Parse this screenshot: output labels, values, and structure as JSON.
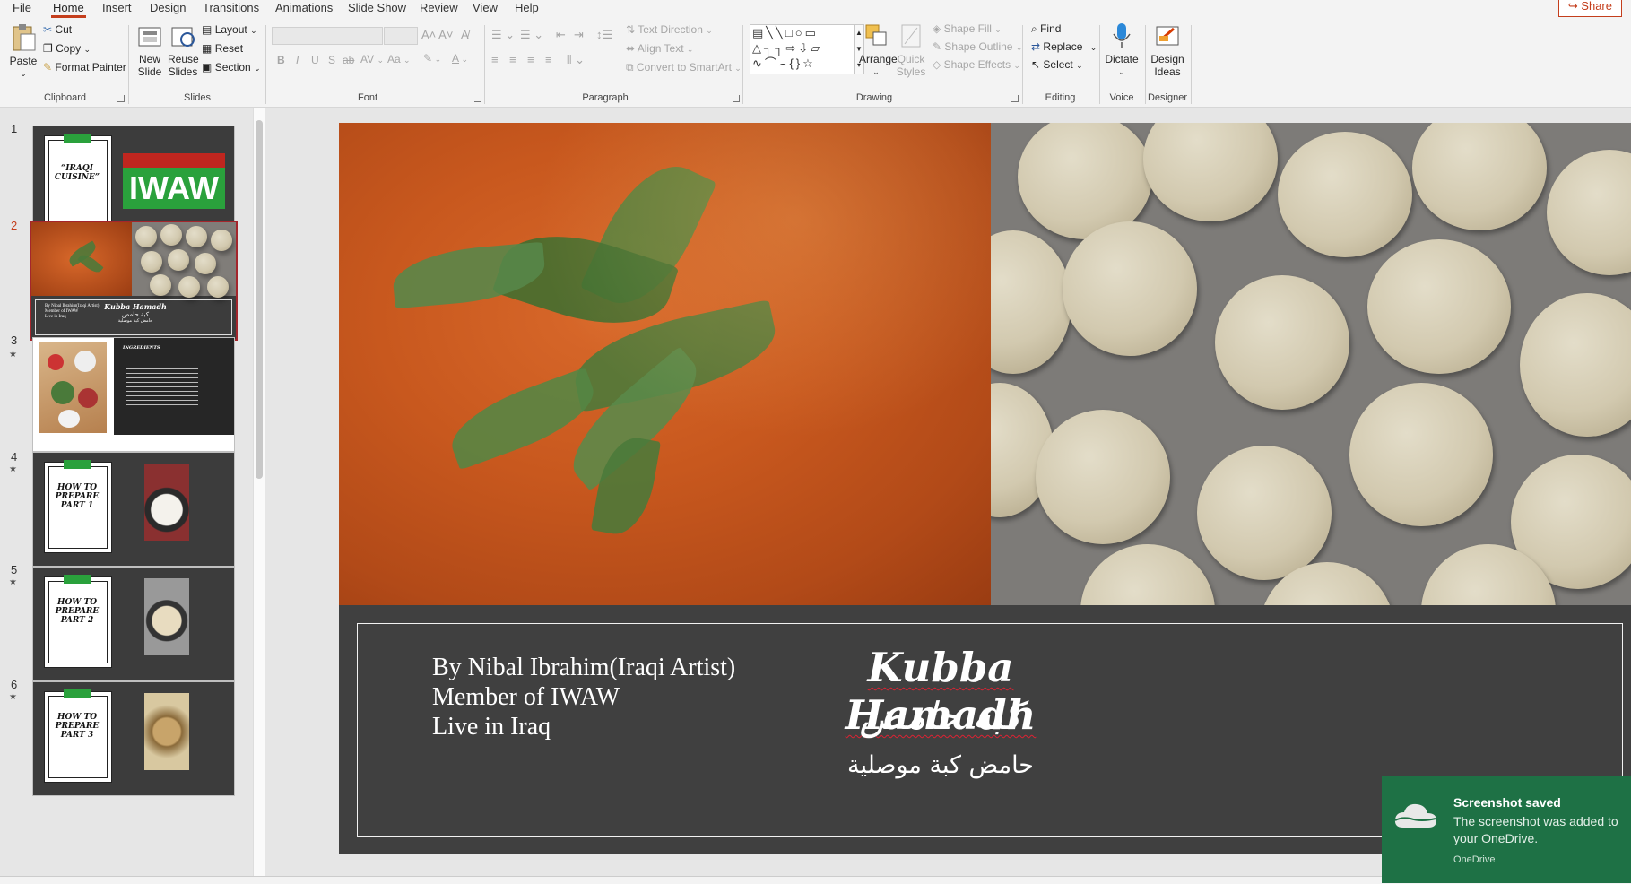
{
  "menu": {
    "tabs": [
      "File",
      "Home",
      "Insert",
      "Design",
      "Transitions",
      "Animations",
      "Slide Show",
      "Review",
      "View",
      "Help"
    ],
    "share": "Share"
  },
  "ribbon": {
    "clipboard": {
      "paste": "Paste",
      "cut": "Cut",
      "copy": "Copy",
      "format_painter": "Format Painter",
      "label": "Clipboard"
    },
    "slides": {
      "new_slide": "New Slide",
      "reuse_slides": "Reuse Slides",
      "layout": "Layout",
      "reset": "Reset",
      "section": "Section",
      "label": "Slides"
    },
    "font": {
      "label": "Font",
      "bold": "B",
      "italic": "I",
      "underline": "U",
      "strike": "S",
      "strike2": "ab",
      "spacing": "AV",
      "case": "Aa"
    },
    "paragraph": {
      "label": "Paragraph",
      "text_direction": "Text Direction",
      "align_text": "Align Text",
      "convert_smartart": "Convert to SmartArt"
    },
    "drawing": {
      "label": "Drawing",
      "arrange": "Arrange",
      "quick_styles": "Quick Styles",
      "shape_fill": "Shape Fill",
      "shape_outline": "Shape Outline",
      "shape_effects": "Shape Effects"
    },
    "editing": {
      "label": "Editing",
      "find": "Find",
      "replace": "Replace",
      "select": "Select"
    },
    "voice": {
      "label": "Voice",
      "dictate": "Dictate"
    },
    "designer": {
      "label": "Designer",
      "design_ideas": "Design Ideas"
    }
  },
  "thumbnails": [
    {
      "num": "1",
      "title": "“IRAQI CUISINE”",
      "logo": "IWAW"
    },
    {
      "num": "2",
      "by": "By Nibal Ibrahim(Iraqi Artist)",
      "member": "Member of IWAW",
      "live": "Live in Iraq",
      "title": "Kubba Hamadh",
      "ar": "كبة حامض",
      "ar2": "حامض كبة موصلية"
    },
    {
      "num": "3",
      "heading": "INGREDIENTS"
    },
    {
      "num": "4",
      "title": "HOW TO PREPARE PART 1"
    },
    {
      "num": "5",
      "title": "HOW TO PREPARE PART 2"
    },
    {
      "num": "6",
      "title": "HOW TO PREPARE PART 3"
    }
  ],
  "slide": {
    "by_lines": [
      "By Nibal Ibrahim(Iraqi Artist)",
      "Member of IWAW",
      "Live in Iraq"
    ],
    "title_en": "Kubba Hamadh",
    "title_ar": "كبة حامض",
    "subtitle_ar": "حامض كبة موصلية"
  },
  "toast": {
    "title": "Screenshot saved",
    "body": "The screenshot was added to your OneDrive.",
    "source": "OneDrive"
  },
  "colors": {
    "accent": "#c43e1c",
    "toast": "#1e7145",
    "slide_bg": "#404040"
  }
}
